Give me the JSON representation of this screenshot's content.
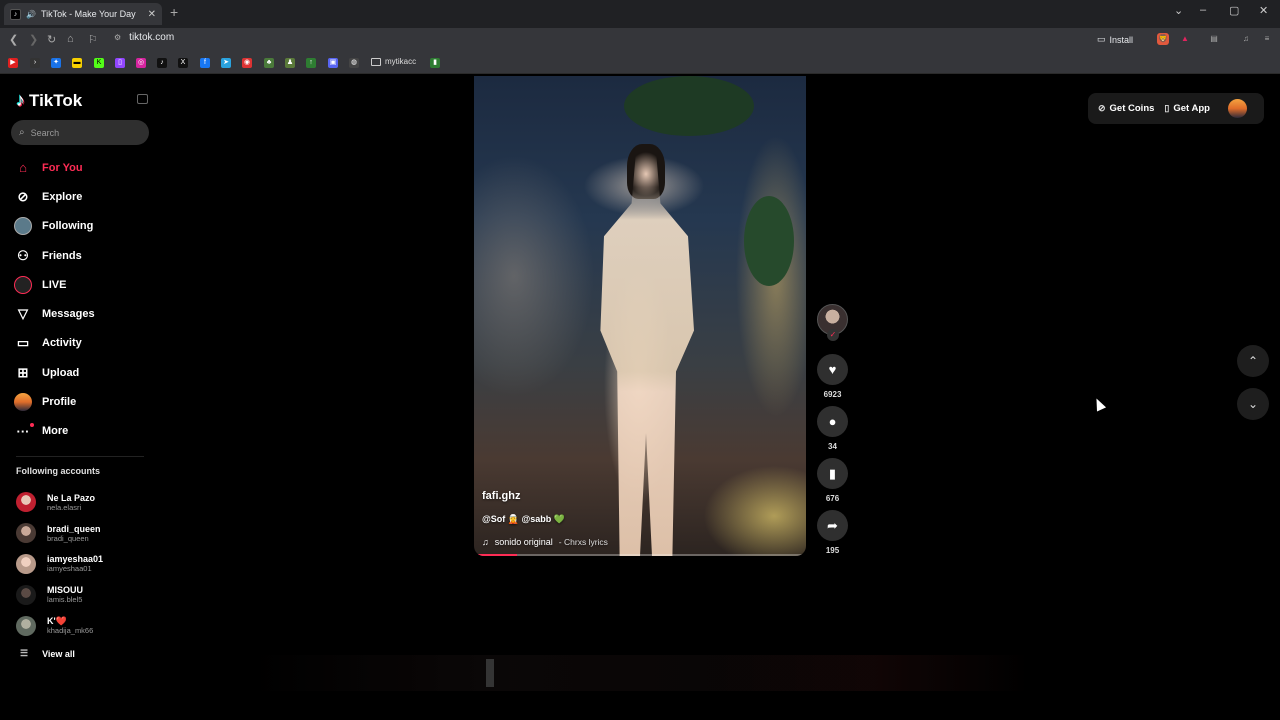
{
  "browser": {
    "tab_title": "TikTok - Make Your Day",
    "url": "tiktok.com",
    "install_label": "Install",
    "bookmark_folder": "mytikacc",
    "new_tab": "+",
    "tab_close": "✕",
    "window_controls": [
      "⌄",
      "–",
      "▢",
      "✕"
    ],
    "nav_icons": [
      "chevron-left-icon",
      "chevron-right-icon",
      "reload-icon",
      "home-icon",
      "bookmark-icon"
    ],
    "bookmark_icons": [
      "youtube-icon",
      "app-icon",
      "app-icon",
      "kick-icon",
      "twitch-icon",
      "instagram-icon",
      "tiktok-icon",
      "x-icon",
      "facebook-icon",
      "telegram-icon",
      "app-icon",
      "app-icon",
      "app-icon",
      "arrow-up-icon",
      "app-icon",
      "globe-icon"
    ]
  },
  "app": {
    "brand": "TikTok",
    "search_placeholder": "Search",
    "accent": "#fe2c55"
  },
  "nav": [
    {
      "label": "For You",
      "icon": "home-icon",
      "active": true
    },
    {
      "label": "Explore",
      "icon": "compass-icon"
    },
    {
      "label": "Following",
      "icon": "following-avatar-icon"
    },
    {
      "label": "Friends",
      "icon": "friends-icon"
    },
    {
      "label": "LIVE",
      "icon": "live-icon"
    },
    {
      "label": "Messages",
      "icon": "messages-icon"
    },
    {
      "label": "Activity",
      "icon": "activity-icon"
    },
    {
      "label": "Upload",
      "icon": "upload-icon"
    },
    {
      "label": "Profile",
      "icon": "profile-avatar-icon"
    },
    {
      "label": "More",
      "icon": "more-icon"
    }
  ],
  "following_accounts": {
    "title": "Following accounts",
    "items": [
      {
        "name": "Ne La Pazo",
        "username": "nela.elasri"
      },
      {
        "name": "bradi_queen",
        "username": "bradi_queen"
      },
      {
        "name": "iamyeshaa01",
        "username": "iamyeshaa01"
      },
      {
        "name": "MISOUU",
        "username": "lamis.blel5"
      },
      {
        "name": "K'❤️",
        "username": "khadija_mk66"
      }
    ],
    "view_all": "View all"
  },
  "video": {
    "author": "fafi.ghz",
    "tags": "@Sof 🧝 @sabb 💚",
    "sound": "sonido original",
    "sound_by": "Chrxs lyrics",
    "progress": 0.13
  },
  "actions": {
    "likes": "6923",
    "comments": "34",
    "saves": "676",
    "shares": "195"
  },
  "topbar": {
    "get_coins": "Get Coins",
    "get_app": "Get App"
  }
}
